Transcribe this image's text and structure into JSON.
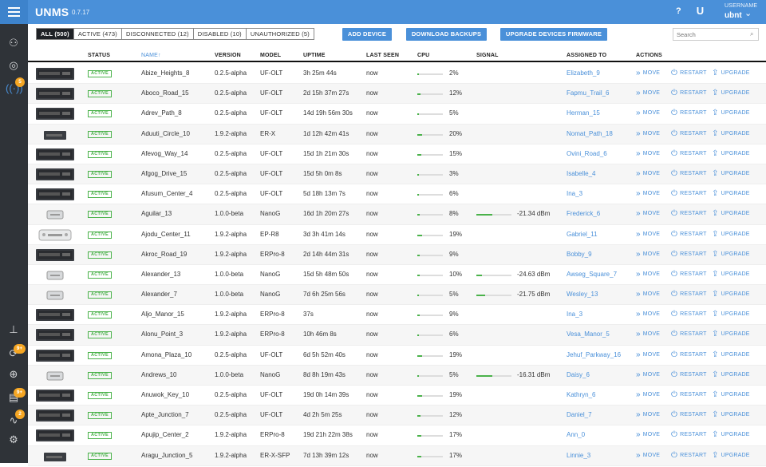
{
  "app": {
    "name": "UNMS",
    "version": "0.7.17",
    "help": "?",
    "user_label": "USERNAME",
    "username": "ubnt"
  },
  "sidebar": {
    "badges": {
      "updates": "5",
      "notifications": "9+",
      "logs": "9+",
      "outages": "2"
    }
  },
  "toolbar": {
    "filters": [
      "ALL (500)",
      "ACTIVE (473)",
      "DISCONNECTED (12)",
      "DISABLED (10)",
      "UNAUTHORIZED (5)"
    ],
    "active_filter": 0,
    "add_device": "ADD DEVICE",
    "download_backups": "DOWNLOAD BACKUPS",
    "upgrade_firmware": "UPGRADE DEVICES FIRMWARE",
    "search_placeholder": "Search"
  },
  "columns": {
    "status": "STATUS",
    "name": "NAME",
    "version": "VERSION",
    "model": "MODEL",
    "uptime": "UPTIME",
    "last_seen": "LAST SEEN",
    "cpu": "CPU",
    "signal": "SIGNAL",
    "assigned": "ASSIGNED TO",
    "actions": "ACTIONS"
  },
  "actions": {
    "move": "MOVE",
    "restart": "RESTART",
    "upgrade": "UPGRADE"
  },
  "colors": {
    "accent": "#4a90d9",
    "active": "#4ab24a",
    "sidebar": "#2f3338"
  },
  "devices": [
    {
      "type": "olt",
      "status": "ACTIVE",
      "name": "Abize_Heights_8",
      "version": "0.2.5-alpha",
      "model": "UF-OLT",
      "uptime": "3h 25m 44s",
      "last_seen": "now",
      "cpu": 2,
      "cpu_label": "2%",
      "signal": null,
      "signal_label": "",
      "assigned": "Elizabeth_9"
    },
    {
      "type": "olt",
      "status": "ACTIVE",
      "name": "Aboco_Road_15",
      "version": "0.2.5-alpha",
      "model": "UF-OLT",
      "uptime": "2d 15h 37m 27s",
      "last_seen": "now",
      "cpu": 12,
      "cpu_label": "12%",
      "signal": null,
      "signal_label": "",
      "assigned": "Fapmu_Trail_6"
    },
    {
      "type": "olt",
      "status": "ACTIVE",
      "name": "Adrev_Path_8",
      "version": "0.2.5-alpha",
      "model": "UF-OLT",
      "uptime": "14d 19h 56m 30s",
      "last_seen": "now",
      "cpu": 5,
      "cpu_label": "5%",
      "signal": null,
      "signal_label": "",
      "assigned": "Herman_15"
    },
    {
      "type": "erx",
      "status": "ACTIVE",
      "name": "Aduuti_Circle_10",
      "version": "1.9.2-alpha",
      "model": "ER-X",
      "uptime": "1d 12h 42m 41s",
      "last_seen": "now",
      "cpu": 20,
      "cpu_label": "20%",
      "signal": null,
      "signal_label": "",
      "assigned": "Nomat_Path_18"
    },
    {
      "type": "olt",
      "status": "ACTIVE",
      "name": "Afevog_Way_14",
      "version": "0.2.5-alpha",
      "model": "UF-OLT",
      "uptime": "15d 1h 21m 30s",
      "last_seen": "now",
      "cpu": 15,
      "cpu_label": "15%",
      "signal": null,
      "signal_label": "",
      "assigned": "Ovini_Road_6"
    },
    {
      "type": "olt",
      "status": "ACTIVE",
      "name": "Afgog_Drive_15",
      "version": "0.2.5-alpha",
      "model": "UF-OLT",
      "uptime": "15d 5h 0m 8s",
      "last_seen": "now",
      "cpu": 3,
      "cpu_label": "3%",
      "signal": null,
      "signal_label": "",
      "assigned": "Isabelle_4"
    },
    {
      "type": "olt",
      "status": "ACTIVE",
      "name": "Afusum_Center_4",
      "version": "0.2.5-alpha",
      "model": "UF-OLT",
      "uptime": "5d 18h 13m 7s",
      "last_seen": "now",
      "cpu": 6,
      "cpu_label": "6%",
      "signal": null,
      "signal_label": "",
      "assigned": "Ina_3"
    },
    {
      "type": "nano",
      "status": "ACTIVE",
      "name": "Aguilar_13",
      "version": "1.0.0-beta",
      "model": "NanoG",
      "uptime": "16d 1h 20m 27s",
      "last_seen": "now",
      "cpu": 8,
      "cpu_label": "8%",
      "signal": 45,
      "signal_label": "-21.34 dBm",
      "assigned": "Frederick_6"
    },
    {
      "type": "ep",
      "status": "ACTIVE",
      "name": "Ajodu_Center_11",
      "version": "1.9.2-alpha",
      "model": "EP-R8",
      "uptime": "3d 3h 41m 14s",
      "last_seen": "now",
      "cpu": 19,
      "cpu_label": "19%",
      "signal": null,
      "signal_label": "",
      "assigned": "Gabriel_11"
    },
    {
      "type": "olt",
      "status": "ACTIVE",
      "name": "Akroc_Road_19",
      "version": "1.9.2-alpha",
      "model": "ERPro-8",
      "uptime": "2d 14h 44m 31s",
      "last_seen": "now",
      "cpu": 9,
      "cpu_label": "9%",
      "signal": null,
      "signal_label": "",
      "assigned": "Bobby_9"
    },
    {
      "type": "nano",
      "status": "ACTIVE",
      "name": "Alexander_13",
      "version": "1.0.0-beta",
      "model": "NanoG",
      "uptime": "15d 5h 48m 50s",
      "last_seen": "now",
      "cpu": 10,
      "cpu_label": "10%",
      "signal": 15,
      "signal_label": "-24.63 dBm",
      "assigned": "Awseg_Square_7"
    },
    {
      "type": "nano",
      "status": "ACTIVE",
      "name": "Alexander_7",
      "version": "1.0.0-beta",
      "model": "NanoG",
      "uptime": "7d 6h 25m 56s",
      "last_seen": "now",
      "cpu": 5,
      "cpu_label": "5%",
      "signal": 25,
      "signal_label": "-21.75 dBm",
      "assigned": "Wesley_13"
    },
    {
      "type": "olt",
      "status": "ACTIVE",
      "name": "Aljo_Manor_15",
      "version": "1.9.2-alpha",
      "model": "ERPro-8",
      "uptime": "37s",
      "last_seen": "now",
      "cpu": 9,
      "cpu_label": "9%",
      "signal": null,
      "signal_label": "",
      "assigned": "Ina_3"
    },
    {
      "type": "olt",
      "status": "ACTIVE",
      "name": "Alonu_Point_3",
      "version": "1.9.2-alpha",
      "model": "ERPro-8",
      "uptime": "10h 46m 8s",
      "last_seen": "now",
      "cpu": 6,
      "cpu_label": "6%",
      "signal": null,
      "signal_label": "",
      "assigned": "Vesa_Manor_5"
    },
    {
      "type": "olt",
      "status": "ACTIVE",
      "name": "Amona_Plaza_10",
      "version": "0.2.5-alpha",
      "model": "UF-OLT",
      "uptime": "6d 5h 52m 40s",
      "last_seen": "now",
      "cpu": 19,
      "cpu_label": "19%",
      "signal": null,
      "signal_label": "",
      "assigned": "Jehuf_Parkway_16"
    },
    {
      "type": "nano",
      "status": "ACTIVE",
      "name": "Andrews_10",
      "version": "1.0.0-beta",
      "model": "NanoG",
      "uptime": "8d 8h 19m 43s",
      "last_seen": "now",
      "cpu": 5,
      "cpu_label": "5%",
      "signal": 45,
      "signal_label": "-16.31 dBm",
      "assigned": "Daisy_6"
    },
    {
      "type": "olt",
      "status": "ACTIVE",
      "name": "Anuwok_Key_10",
      "version": "0.2.5-alpha",
      "model": "UF-OLT",
      "uptime": "19d 0h 14m 39s",
      "last_seen": "now",
      "cpu": 19,
      "cpu_label": "19%",
      "signal": null,
      "signal_label": "",
      "assigned": "Kathryn_6"
    },
    {
      "type": "olt",
      "status": "ACTIVE",
      "name": "Apte_Junction_7",
      "version": "0.2.5-alpha",
      "model": "UF-OLT",
      "uptime": "4d 2h 5m 25s",
      "last_seen": "now",
      "cpu": 12,
      "cpu_label": "12%",
      "signal": null,
      "signal_label": "",
      "assigned": "Daniel_7"
    },
    {
      "type": "olt",
      "status": "ACTIVE",
      "name": "Apujip_Center_2",
      "version": "1.9.2-alpha",
      "model": "ERPro-8",
      "uptime": "19d 21h 22m 38s",
      "last_seen": "now",
      "cpu": 17,
      "cpu_label": "17%",
      "signal": null,
      "signal_label": "",
      "assigned": "Ann_0"
    },
    {
      "type": "erx",
      "status": "ACTIVE",
      "name": "Aragu_Junction_5",
      "version": "1.9.2-alpha",
      "model": "ER-X-SFP",
      "uptime": "7d 13h 39m 12s",
      "last_seen": "now",
      "cpu": 17,
      "cpu_label": "17%",
      "signal": null,
      "signal_label": "",
      "assigned": "Linnie_3"
    }
  ]
}
